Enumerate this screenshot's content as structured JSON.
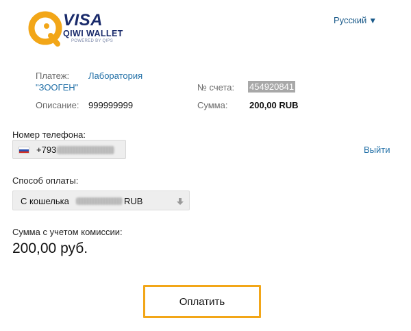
{
  "brand": {
    "logo_visa": "VISA",
    "logo_wallet": "QIWI WALLET",
    "logo_powered": "POWERED BY QIPS",
    "accent_orange": "#f2a618",
    "navy": "#1a2b6b"
  },
  "language": {
    "label": "Русский",
    "icon": "caret-down-icon"
  },
  "payment": {
    "payee_label": "Платеж:",
    "payee_line1": "Лаборатория",
    "payee_line2": "\"ЗООГЕН\"",
    "description_label": "Описание:",
    "description_value": "999999999",
    "account_label": "№ счета:",
    "account_value": "454920841",
    "amount_label": "Сумма:",
    "amount_value": "200,00 RUB"
  },
  "phone": {
    "label": "Номер телефона:",
    "prefix": "+793",
    "logout": "Выйти",
    "flag": "russia-flag-icon"
  },
  "payment_method": {
    "label": "Способ оплаты:",
    "value_prefix": "С кошелька",
    "value_suffix": "RUB",
    "icon": "arrow-down-icon"
  },
  "total": {
    "label": "Сумма с учетом комиссии:",
    "value": "200,00 руб."
  },
  "actions": {
    "pay_label": "Оплатить"
  }
}
